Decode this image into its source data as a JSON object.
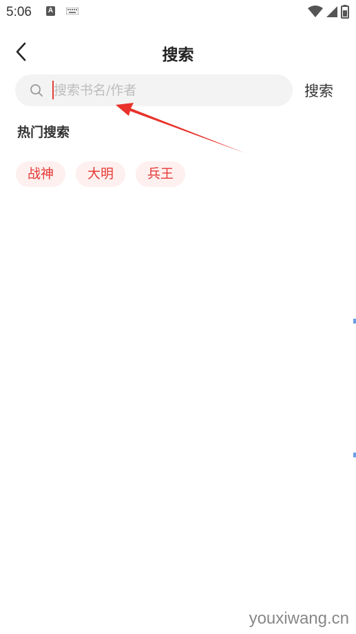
{
  "status_bar": {
    "time": "5:06",
    "left_icons": [
      "accessibility-a-icon",
      "keyboard-icon"
    ],
    "right_icons": [
      "wifi-icon",
      "cell-signal-icon",
      "battery-icon"
    ],
    "a_glyph": "A"
  },
  "header": {
    "title": "搜索",
    "back_icon": "chevron-left-icon"
  },
  "search": {
    "placeholder": "搜索书名/作者",
    "value": "",
    "submit_label": "搜索",
    "icon": "search-icon"
  },
  "hot_search": {
    "title": "热门搜索",
    "tags": [
      {
        "label": "战神"
      },
      {
        "label": "大明"
      },
      {
        "label": "兵王"
      }
    ]
  },
  "annotation": {
    "color": "#e8322b"
  },
  "colors": {
    "accent": "#e53935",
    "tag_bg": "#fdf0ef",
    "search_bg": "#f3f3f3"
  },
  "watermark": "youxiwang.cn"
}
